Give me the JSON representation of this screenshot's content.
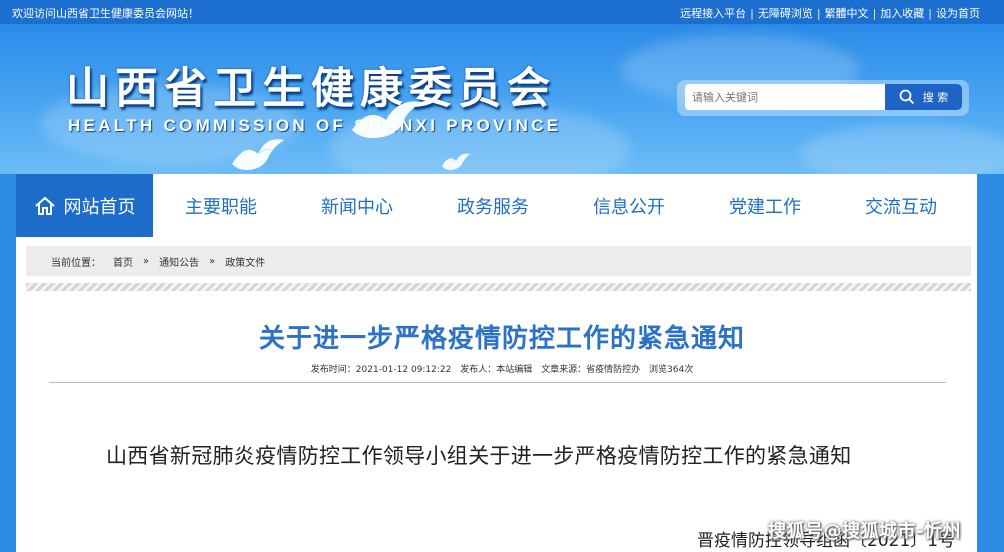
{
  "topbar": {
    "welcome": "欢迎访问山西省卫生健康委员会网站！",
    "links": [
      "远程接入平台",
      "无障碍浏览",
      "繁體中文",
      "加入收藏",
      "设为首页"
    ],
    "separator": "|"
  },
  "header": {
    "title_cn": "山西省卫生健康委员会",
    "title_en": "HEALTH COMMISSION OF SHANXI PROVINCE"
  },
  "search": {
    "placeholder": "请输入关键词",
    "button_label": "搜 索",
    "icon": "search-icon"
  },
  "nav": {
    "items": [
      {
        "label": "网站首页",
        "icon": "home-icon",
        "active": true
      },
      {
        "label": "主要职能"
      },
      {
        "label": "新闻中心"
      },
      {
        "label": "政务服务"
      },
      {
        "label": "信息公开"
      },
      {
        "label": "党建工作"
      },
      {
        "label": "交流互动"
      }
    ]
  },
  "breadcrumb": {
    "prefix": "当前位置：",
    "items": [
      "首页",
      "通知公告",
      "政策文件"
    ],
    "arrow": "»"
  },
  "article": {
    "title": "关于进一步严格疫情防控工作的紧急通知",
    "meta": {
      "published": "发布时间：2021-01-12 09:12:22",
      "publisher": "发布人：本站编辑",
      "source": "文章来源：省疫情防控办",
      "views": "浏览364次"
    },
    "heading": "山西省新冠肺炎疫情防控工作领导小组关于进一步严格疫情防控工作的紧急通知",
    "doc_number": "晋疫情防控领导组函〔2021〕1号"
  },
  "watermark": "搜狐号@搜狐城市-忻州",
  "colors": {
    "banner": "#2f8ce6",
    "topbar": "#1d6fcf",
    "nav_active": "#1e6cc9",
    "nav_text": "#1f6fc4",
    "title": "#2c72c7"
  }
}
